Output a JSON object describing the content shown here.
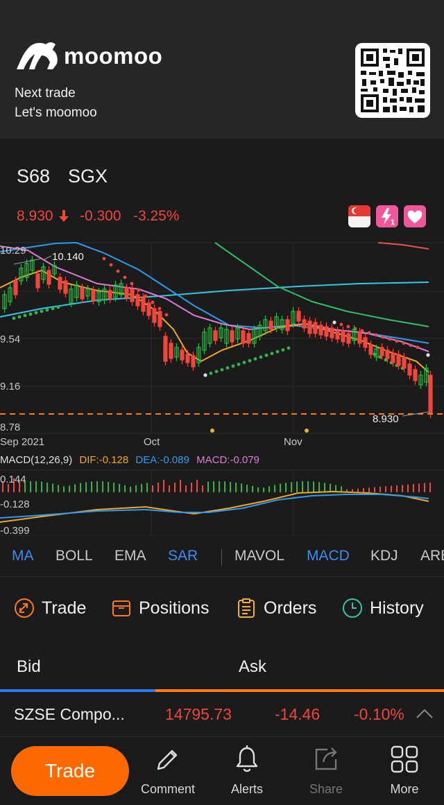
{
  "promo": {
    "brand": "moomoo",
    "line1": "Next trade",
    "line2": "Let's moomoo"
  },
  "stock": {
    "symbol": "S68",
    "exchange": "SGX",
    "price": "8.930",
    "change": "-0.300",
    "change_pct": "-3.25%"
  },
  "chart": {
    "y_labels": [
      "10.29",
      "9.54",
      "9.16",
      "8.78"
    ],
    "x_labels": [
      "Sep 2021",
      "Oct",
      "Nov"
    ],
    "high_label": "10.140",
    "last_price_label": "8.930",
    "macd": {
      "title": "MACD(12,26,9)",
      "dif": "DIF:-0.128",
      "dea": "DEA:-0.089",
      "macd": "MACD:-0.079",
      "y_labels": [
        "0.144",
        "-0.128",
        "-0.399"
      ]
    },
    "colors": {
      "up": "#2fb84a",
      "down": "#f0463c",
      "ma_orange": "#f5a623",
      "ma_blue": "#2d9cf0",
      "ma_pink": "#e27bd6",
      "ma_cyan": "#32c8e8",
      "ma_green": "#2fbf6a",
      "ma_red": "#e8554a",
      "price_line": "#ff7a1a"
    }
  },
  "indicators": {
    "main": [
      {
        "label": "MA",
        "active": true
      },
      {
        "label": "BOLL",
        "active": false
      },
      {
        "label": "EMA",
        "active": false
      },
      {
        "label": "SAR",
        "active": true
      }
    ],
    "sub": [
      {
        "label": "MAVOL",
        "active": false
      },
      {
        "label": "MACD",
        "active": true
      },
      {
        "label": "KDJ",
        "active": false
      },
      {
        "label": "ARB",
        "active": false
      }
    ]
  },
  "actions": {
    "trade": "Trade",
    "positions": "Positions",
    "orders": "Orders",
    "history": "History"
  },
  "bidask": {
    "bid": "Bid",
    "ask": "Ask"
  },
  "index": {
    "name": "SZSE Compo...",
    "value": "14795.73",
    "change": "-14.46",
    "change_pct": "-0.10%"
  },
  "nav": {
    "trade": "Trade",
    "comment": "Comment",
    "alerts": "Alerts",
    "share": "Share",
    "more": "More"
  }
}
